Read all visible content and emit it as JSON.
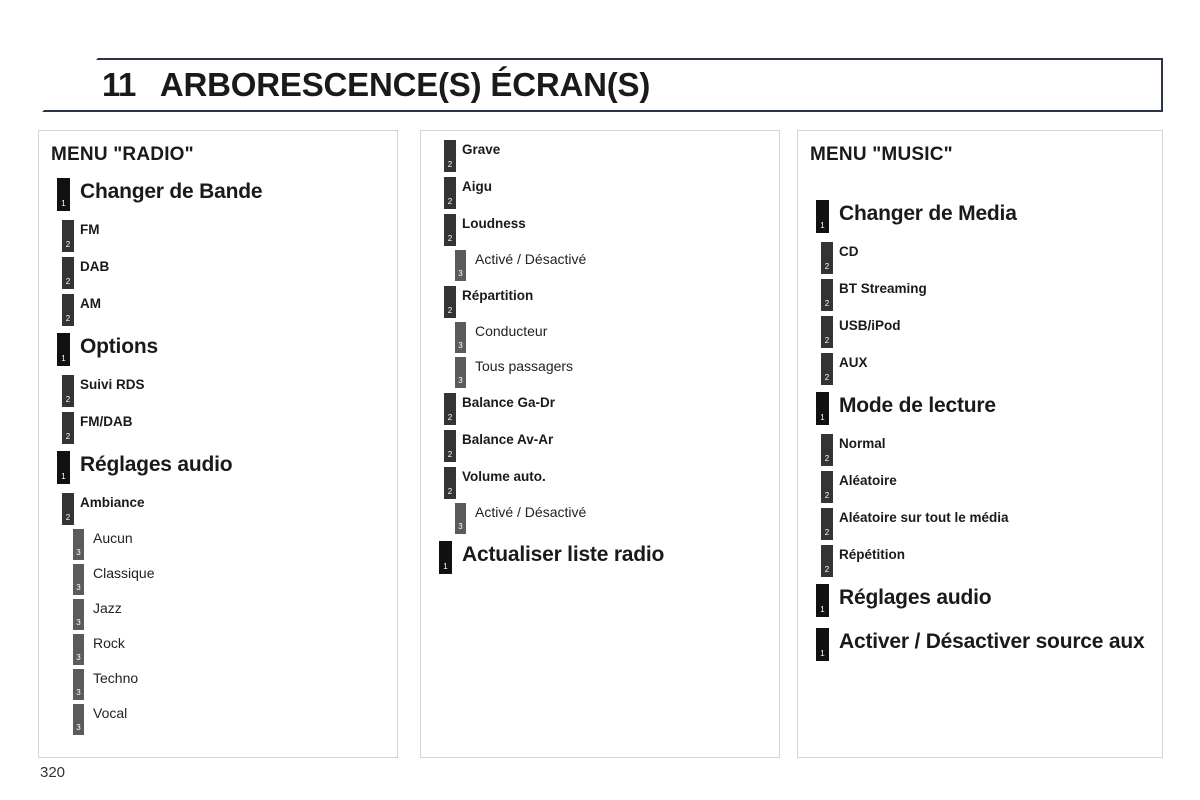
{
  "header": {
    "chapter_number": "11",
    "title": "ARBORESCENCE(S) ÉCRAN(S)"
  },
  "page_number": "320",
  "colors": {
    "header_border": "#2b3347",
    "level1_marker": "#111111",
    "level2_marker": "#343434",
    "level3_marker": "#5b5b5b",
    "column_border": "#d3d3d3"
  },
  "columns": [
    {
      "id": "column-1",
      "heading": "MENU \"RADIO\"",
      "nodes": [
        {
          "level": 1,
          "label": "Changer de Bande",
          "marker": "1"
        },
        {
          "level": 2,
          "label": "FM",
          "marker": "2"
        },
        {
          "level": 2,
          "label": "DAB",
          "marker": "2"
        },
        {
          "level": 2,
          "label": "AM",
          "marker": "2"
        },
        {
          "level": 1,
          "label": "Options",
          "marker": "1"
        },
        {
          "level": 2,
          "label": "Suivi RDS",
          "marker": "2"
        },
        {
          "level": 2,
          "label": "FM/DAB",
          "marker": "2"
        },
        {
          "level": 1,
          "label": "Réglages audio",
          "marker": "1"
        },
        {
          "level": 2,
          "label": "Ambiance",
          "marker": "2"
        },
        {
          "level": 3,
          "label": "Aucun",
          "marker": "3"
        },
        {
          "level": 3,
          "label": "Classique",
          "marker": "3"
        },
        {
          "level": 3,
          "label": "Jazz",
          "marker": "3"
        },
        {
          "level": 3,
          "label": "Rock",
          "marker": "3"
        },
        {
          "level": 3,
          "label": "Techno",
          "marker": "3"
        },
        {
          "level": 3,
          "label": "Vocal",
          "marker": "3"
        }
      ]
    },
    {
      "id": "column-2",
      "heading": "",
      "nodes": [
        {
          "level": 2,
          "label": "Grave",
          "marker": "2"
        },
        {
          "level": 2,
          "label": "Aigu",
          "marker": "2"
        },
        {
          "level": 2,
          "label": "Loudness",
          "marker": "2"
        },
        {
          "level": 3,
          "label": "Activé / Désactivé",
          "marker": "3"
        },
        {
          "level": 2,
          "label": "Répartition",
          "marker": "2"
        },
        {
          "level": 3,
          "label": "Conducteur",
          "marker": "3"
        },
        {
          "level": 3,
          "label": "Tous passagers",
          "marker": "3"
        },
        {
          "level": 2,
          "label": "Balance Ga-Dr",
          "marker": "2"
        },
        {
          "level": 2,
          "label": "Balance Av-Ar",
          "marker": "2"
        },
        {
          "level": 2,
          "label": "Volume auto.",
          "marker": "2"
        },
        {
          "level": 3,
          "label": "Activé / Désactivé",
          "marker": "3"
        },
        {
          "level": 1,
          "label": "Actualiser liste radio",
          "marker": "1"
        }
      ]
    },
    {
      "id": "column-3",
      "heading": "MENU \"MUSIC\"",
      "nodes": [
        {
          "level": 1,
          "label": "Changer de Media",
          "marker": "1"
        },
        {
          "level": 2,
          "label": "CD",
          "marker": "2"
        },
        {
          "level": 2,
          "label": "BT Streaming",
          "marker": "2"
        },
        {
          "level": 2,
          "label": "USB/iPod",
          "marker": "2"
        },
        {
          "level": 2,
          "label": "AUX",
          "marker": "2"
        },
        {
          "level": 1,
          "label": "Mode de lecture",
          "marker": "1"
        },
        {
          "level": 2,
          "label": "Normal",
          "marker": "2"
        },
        {
          "level": 2,
          "label": "Aléatoire",
          "marker": "2"
        },
        {
          "level": 2,
          "label": "Aléatoire sur tout le média",
          "marker": "2"
        },
        {
          "level": 2,
          "label": "Répétition",
          "marker": "2"
        },
        {
          "level": 1,
          "label": "Réglages audio",
          "marker": "1"
        },
        {
          "level": 1,
          "label": "Activer / Désactiver source aux",
          "marker": "1"
        }
      ]
    }
  ]
}
